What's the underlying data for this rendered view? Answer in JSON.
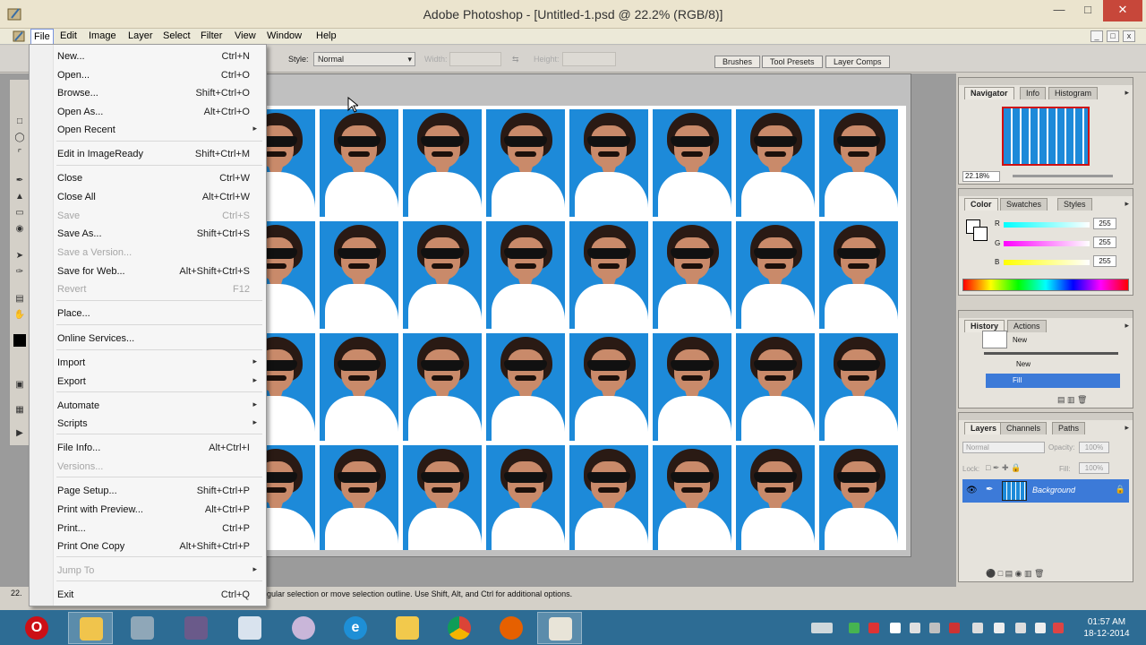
{
  "window": {
    "title": "Adobe Photoshop - [Untitled-1.psd @ 22.2% (RGB/8)]"
  },
  "menubar": {
    "items": [
      "File",
      "Edit",
      "Image",
      "Layer",
      "Select",
      "Filter",
      "View",
      "Window",
      "Help"
    ],
    "active": "File"
  },
  "options": {
    "style_label": "Style:",
    "style_value": "Normal",
    "width_label": "Width:",
    "height_label": "Height:",
    "wells": [
      "Brushes",
      "Tool Presets",
      "Layer Comps"
    ]
  },
  "file_menu": {
    "items": [
      {
        "label": "New...",
        "shortcut": "Ctrl+N"
      },
      {
        "label": "Open...",
        "shortcut": "Ctrl+O"
      },
      {
        "label": "Browse...",
        "shortcut": "Shift+Ctrl+O"
      },
      {
        "label": "Open As...",
        "shortcut": "Alt+Ctrl+O"
      },
      {
        "label": "Open Recent",
        "shortcut": ""
      },
      {
        "label": "Edit in ImageReady",
        "shortcut": "Shift+Ctrl+M"
      },
      {
        "label": "Close",
        "shortcut": "Ctrl+W"
      },
      {
        "label": "Close All",
        "shortcut": "Alt+Ctrl+W"
      },
      {
        "label": "Save",
        "shortcut": "Ctrl+S"
      },
      {
        "label": "Save As...",
        "shortcut": "Shift+Ctrl+S"
      },
      {
        "label": "Save a Version...",
        "shortcut": ""
      },
      {
        "label": "Save for Web...",
        "shortcut": "Alt+Shift+Ctrl+S"
      },
      {
        "label": "Revert",
        "shortcut": "F12"
      },
      {
        "label": "Place...",
        "shortcut": ""
      },
      {
        "label": "Online Services...",
        "shortcut": ""
      },
      {
        "label": "Import",
        "shortcut": ""
      },
      {
        "label": "Export",
        "shortcut": ""
      },
      {
        "label": "Automate",
        "shortcut": ""
      },
      {
        "label": "Scripts",
        "shortcut": ""
      },
      {
        "label": "File Info...",
        "shortcut": "Alt+Ctrl+I"
      },
      {
        "label": "Versions...",
        "shortcut": ""
      },
      {
        "label": "Page Setup...",
        "shortcut": "Shift+Ctrl+P"
      },
      {
        "label": "Print with Preview...",
        "shortcut": "Alt+Ctrl+P"
      },
      {
        "label": "Print...",
        "shortcut": "Ctrl+P"
      },
      {
        "label": "Print One Copy",
        "shortcut": "Alt+Shift+Ctrl+P"
      },
      {
        "label": "Jump To",
        "shortcut": ""
      },
      {
        "label": "Exit",
        "shortcut": "Ctrl+Q"
      }
    ]
  },
  "statusbar": {
    "zoom": "22.",
    "hint": "gular selection or move selection outline.  Use Shift, Alt, and Ctrl for additional options."
  },
  "navigator": {
    "tabs": [
      "Navigator",
      "Info",
      "Histogram"
    ],
    "zoom": "22.18%"
  },
  "color": {
    "tabs": [
      "Color",
      "Swatches",
      "Styles"
    ],
    "channels": [
      {
        "label": "R",
        "value": "255"
      },
      {
        "label": "G",
        "value": "255"
      },
      {
        "label": "B",
        "value": "255"
      }
    ]
  },
  "history": {
    "tabs": [
      "History",
      "Actions"
    ],
    "snapshot": "New",
    "states": [
      "New",
      "Fill"
    ]
  },
  "layers": {
    "tabs": [
      "Layers",
      "Channels",
      "Paths"
    ],
    "blend_mode": "Normal",
    "opacity_label": "Opacity:",
    "opacity": "100%",
    "lock_label": "Lock:",
    "fill_label": "Fill:",
    "fill": "100%",
    "layer_name": "Background"
  },
  "taskbar": {
    "time": "01:57 AM",
    "date": "18-12-2014"
  }
}
